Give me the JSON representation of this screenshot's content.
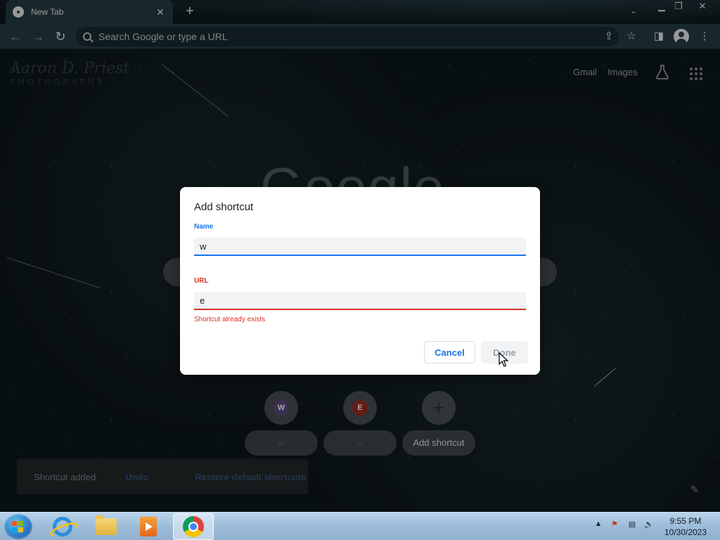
{
  "browser": {
    "tab_title": "New Tab",
    "omnibox_placeholder": "Search Google or type a URL"
  },
  "ntp": {
    "watermark_line1": "Aaron D. Priest",
    "watermark_line2": "PHOTOGRAPHY",
    "gmail_link": "Gmail",
    "images_link": "Images",
    "logo_text": "Google",
    "shortcuts": [
      {
        "letter": "W",
        "label": "w",
        "color": "#5c4a7d"
      },
      {
        "letter": "E",
        "label": "w",
        "color": "#9c2a22"
      }
    ],
    "add_shortcut_label": "Add shortcut",
    "snackbar": {
      "message": "Shortcut added",
      "undo": "Undo",
      "restore": "Restore default shortcuts"
    }
  },
  "dialog": {
    "title": "Add shortcut",
    "name_label": "Name",
    "name_value": "w",
    "url_label": "URL",
    "url_value": "e",
    "error": "Shortcut already exists",
    "cancel": "Cancel",
    "done": "Done"
  },
  "taskbar": {
    "time": "9:55 PM",
    "date": "10/30/2023"
  }
}
